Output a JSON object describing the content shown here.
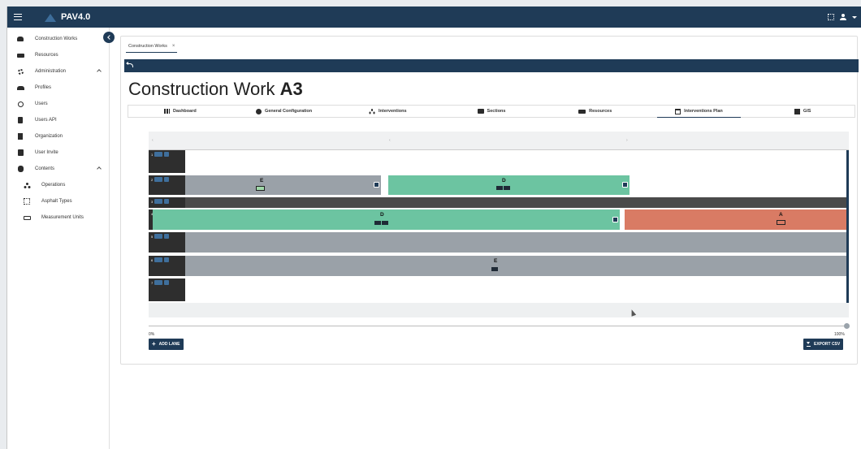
{
  "app": {
    "title": "PAV4.0"
  },
  "sidebar": {
    "items": [
      {
        "label": "Construction Works",
        "icon": "workers-icon"
      },
      {
        "label": "Resources",
        "icon": "truck-icon"
      },
      {
        "label": "Administration",
        "icon": "gear-icon",
        "expanded": true
      },
      {
        "label": "Profiles",
        "icon": "group-icon"
      },
      {
        "label": "Users",
        "icon": "user-circle-icon"
      },
      {
        "label": "Users API",
        "icon": "file-icon"
      },
      {
        "label": "Organization",
        "icon": "bookmark-icon"
      },
      {
        "label": "User Invite",
        "icon": "book-icon"
      },
      {
        "label": "Contents",
        "icon": "database-icon",
        "expanded": true
      },
      {
        "label": "Operations",
        "icon": "operations-icon"
      },
      {
        "label": "Asphalt Types",
        "icon": "grid-icon"
      },
      {
        "label": "Measurement Units",
        "icon": "ruler-icon"
      }
    ]
  },
  "breadcrumb": {
    "tab_label": "Construction Works",
    "close": "×"
  },
  "page": {
    "title_prefix": "Construction Work",
    "title_code": "A3"
  },
  "tabs": [
    {
      "label": "Dashboard",
      "icon": "bar-chart-icon"
    },
    {
      "label": "General Configuration",
      "icon": "info-icon"
    },
    {
      "label": "Interventions",
      "icon": "operations-icon"
    },
    {
      "label": "Sections",
      "icon": "sections-icon"
    },
    {
      "label": "Resources",
      "icon": "truck-icon"
    },
    {
      "label": "Interventions Plan",
      "icon": "calendar-icon",
      "active": true
    },
    {
      "label": "GIS",
      "icon": "map-icon"
    }
  ],
  "plan": {
    "header_markers": [
      "‹",
      "‹",
      "›"
    ],
    "lane_numbers": [
      "1",
      "2",
      "3",
      "4",
      "5",
      "6",
      "7"
    ],
    "bars": [
      {
        "label": "E",
        "color": "#9aa1a8"
      },
      {
        "label": "D",
        "color": "#6cc4a1"
      },
      {
        "label": "D",
        "color": "#6cc4a1"
      },
      {
        "label": "A",
        "color": "#d97b64"
      },
      {
        "label": "E",
        "color": "#9aa1a8"
      }
    ],
    "progress": {
      "min_label": "0%",
      "max_label": "100%",
      "value": 1.0
    },
    "add_lane_label": "ADD LANE",
    "export_label": "EXPORT CSV"
  },
  "colors": {
    "primary": "#1f3b57",
    "green": "#6cc4a1",
    "grey": "#9aa1a8",
    "orange": "#d97b64"
  }
}
